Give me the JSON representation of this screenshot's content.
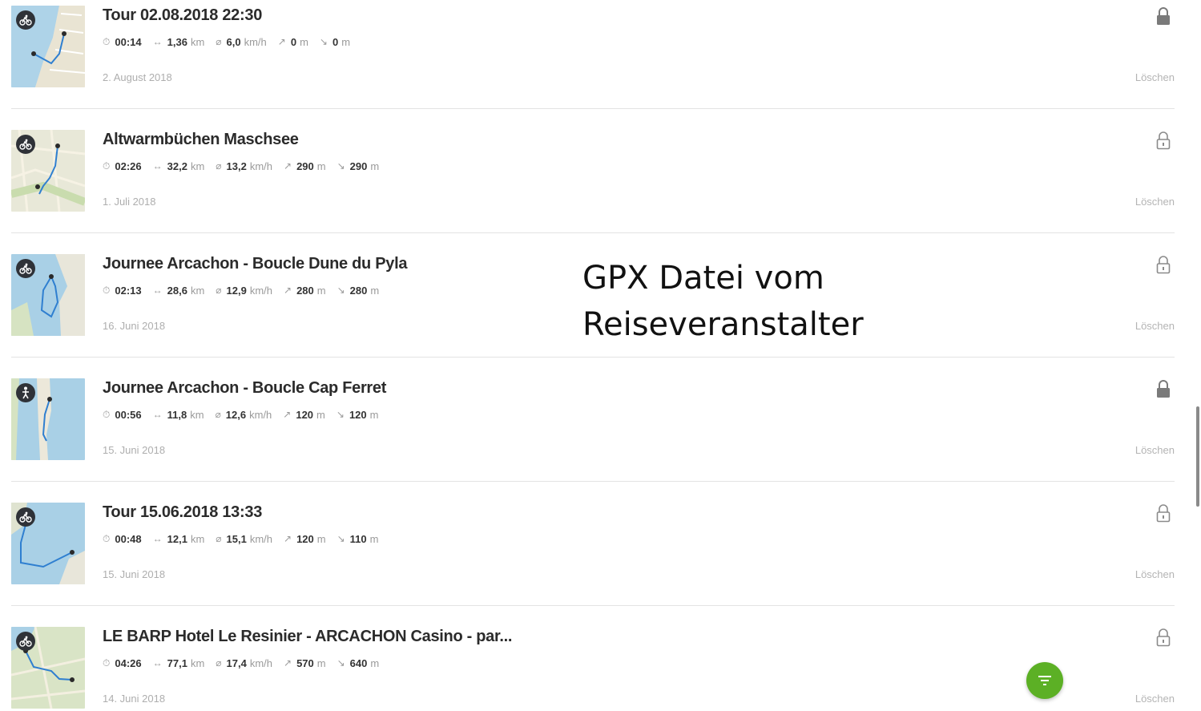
{
  "tours": [
    {
      "title": "Tour 02.08.2018 22:30",
      "sport": "bike-icon",
      "duration": "00:14",
      "distance": "1,36",
      "distance_unit": "km",
      "speed": "6,0",
      "speed_unit": "km/h",
      "ascent": "0",
      "ascent_unit": "m",
      "descent": "0",
      "descent_unit": "m",
      "date": "2. August 2018",
      "delete_label": "Löschen",
      "locked": true
    },
    {
      "title": "Altwarmbüchen Maschsee",
      "sport": "bike-icon",
      "duration": "02:26",
      "distance": "32,2",
      "distance_unit": "km",
      "speed": "13,2",
      "speed_unit": "km/h",
      "ascent": "290",
      "ascent_unit": "m",
      "descent": "290",
      "descent_unit": "m",
      "date": "1. Juli 2018",
      "delete_label": "Löschen",
      "locked": false
    },
    {
      "title": "Journee Arcachon - Boucle Dune du Pyla",
      "sport": "bike-icon",
      "duration": "02:13",
      "distance": "28,6",
      "distance_unit": "km",
      "speed": "12,9",
      "speed_unit": "km/h",
      "ascent": "280",
      "ascent_unit": "m",
      "descent": "280",
      "descent_unit": "m",
      "date": "16. Juni 2018",
      "delete_label": "Löschen",
      "locked": false
    },
    {
      "title": "Journee Arcachon - Boucle Cap Ferret",
      "sport": "hiker-icon",
      "duration": "00:56",
      "distance": "11,8",
      "distance_unit": "km",
      "speed": "12,6",
      "speed_unit": "km/h",
      "ascent": "120",
      "ascent_unit": "m",
      "descent": "120",
      "descent_unit": "m",
      "date": "15. Juni 2018",
      "delete_label": "Löschen",
      "locked": true
    },
    {
      "title": "Tour 15.06.2018 13:33",
      "sport": "bike-icon",
      "duration": "00:48",
      "distance": "12,1",
      "distance_unit": "km",
      "speed": "15,1",
      "speed_unit": "km/h",
      "ascent": "120",
      "ascent_unit": "m",
      "descent": "110",
      "descent_unit": "m",
      "date": "15. Juni 2018",
      "delete_label": "Löschen",
      "locked": false
    },
    {
      "title": "LE BARP Hotel Le Resinier - ARCACHON Casino - par...",
      "sport": "bike-icon",
      "duration": "04:26",
      "distance": "77,1",
      "distance_unit": "km",
      "speed": "17,4",
      "speed_unit": "km/h",
      "ascent": "570",
      "ascent_unit": "m",
      "descent": "640",
      "descent_unit": "m",
      "date": "14. Juni 2018",
      "delete_label": "Löschen",
      "locked": false
    }
  ],
  "overlay": {
    "line1": "GPX Datei vom",
    "line2": "Reiseveranstalter"
  },
  "fab": {
    "icon": "filter-icon"
  },
  "colors": {
    "accent": "#5cb025",
    "title": "#2b2b2b",
    "muted": "#aeaeae",
    "route": "#2f7fd0"
  }
}
